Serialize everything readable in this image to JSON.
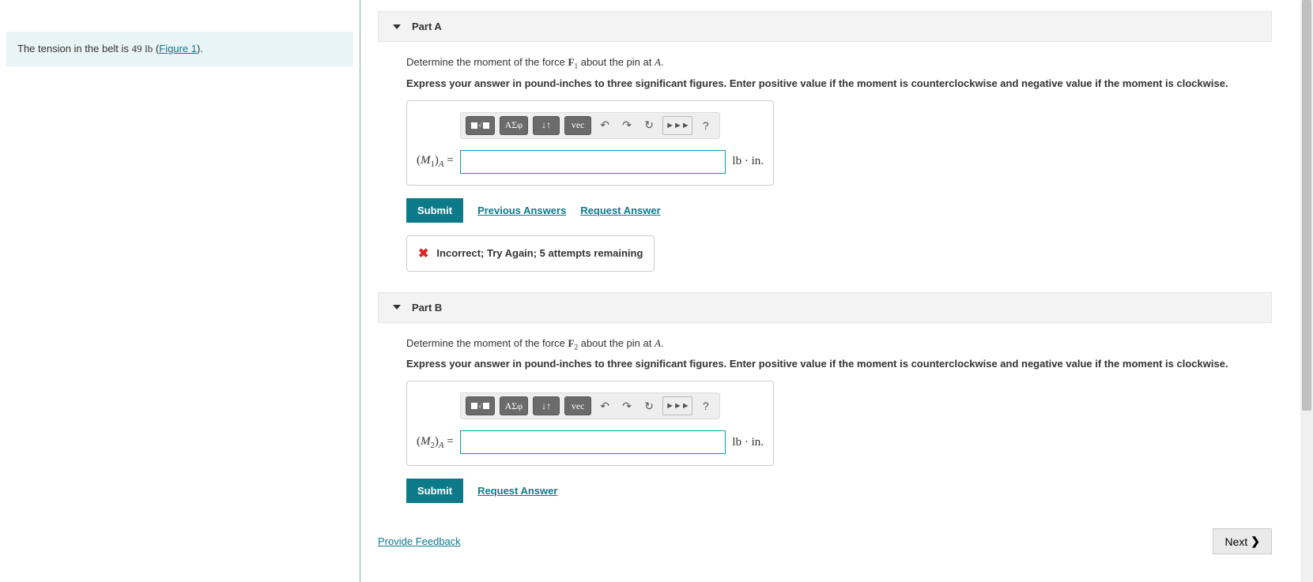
{
  "instruction": {
    "prefix": "The tension in the belt is ",
    "value": "49",
    "unit": "lb",
    "figure_open": "(",
    "figure_link": "Figure 1",
    "figure_close": ")."
  },
  "parts": [
    {
      "title": "Part A",
      "prompt_pre": "Determine the moment of the force ",
      "force_sym": "F",
      "force_sub": "1",
      "prompt_mid": " about the pin at ",
      "point_sym": "A",
      "prompt_post": ".",
      "hint": "Express your answer in pound-inches to three significant figures. Enter positive value if the moment is counterclockwise and negative value if the moment is clockwise.",
      "var_open": "(",
      "var_sym": "M",
      "var_sub": "1",
      "var_close": ")",
      "var_sub2": "A",
      "equals": " =",
      "unit": "lb · in.",
      "submit": "Submit",
      "links": [
        "Previous Answers",
        "Request Answer"
      ],
      "feedback": "Incorrect; Try Again; 5 attempts remaining"
    },
    {
      "title": "Part B",
      "prompt_pre": "Determine the moment of the force ",
      "force_sym": "F",
      "force_sub": "2",
      "prompt_mid": " about the pin at ",
      "point_sym": "A",
      "prompt_post": ".",
      "hint": "Express your answer in pound-inches to three significant figures. Enter positive value if the moment is counterclockwise and negative value if the moment is clockwise.",
      "var_open": "(",
      "var_sym": "M",
      "var_sub": "2",
      "var_close": ")",
      "var_sub2": "A",
      "equals": " =",
      "unit": "lb · in.",
      "submit": "Submit",
      "links": [
        "Request Answer"
      ],
      "feedback": null
    }
  ],
  "toolbar": {
    "fraction": "□√□",
    "greek": "ΑΣφ",
    "updown": "↓↑",
    "vec": "vec",
    "undo": "↶",
    "redo": "↷",
    "reset": "↻",
    "keyboard": "⌨",
    "help": "?"
  },
  "footer": {
    "feedback_link": "Provide Feedback",
    "next": "Next"
  }
}
